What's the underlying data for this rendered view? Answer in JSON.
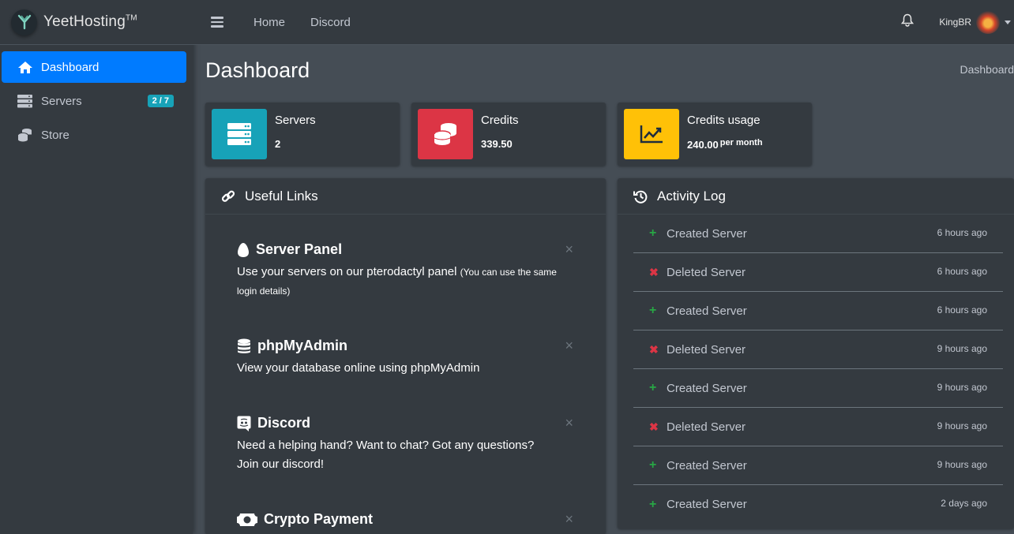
{
  "brand": {
    "name": "YeetHosting",
    "tm": "TM"
  },
  "sidebar": {
    "items": [
      {
        "label": "Dashboard",
        "icon": "home-icon",
        "active": true
      },
      {
        "label": "Servers",
        "icon": "server-icon",
        "badge": "2 / 7"
      },
      {
        "label": "Store",
        "icon": "coins-icon"
      }
    ]
  },
  "topnav": {
    "links": [
      "Home",
      "Discord"
    ],
    "username": "KingBR"
  },
  "page": {
    "title": "Dashboard",
    "breadcrumb": "Dashboard"
  },
  "info_boxes": [
    {
      "label": "Servers",
      "value": "2",
      "color": "#17a2b8",
      "icon": "server-icon"
    },
    {
      "label": "Credits",
      "value": "339.50",
      "color": "#dc3545",
      "icon": "coins-icon"
    },
    {
      "label": "Credits usage",
      "value": "240.00",
      "suffix": "per month",
      "color": "#ffc107",
      "icon": "chart-line-icon"
    }
  ],
  "useful_links": {
    "title": "Useful Links",
    "items": [
      {
        "title": "Server Panel",
        "text": "Use your servers on our pterodactyl panel",
        "small": "(You can use the same login details)",
        "icon": "egg-icon"
      },
      {
        "title": "phpMyAdmin",
        "text": "View your database online using phpMyAdmin",
        "icon": "database-icon"
      },
      {
        "title": "Discord",
        "text": "Need a helping hand? Want to chat? Got any questions? Join our discord!",
        "icon": "discord-icon"
      },
      {
        "title": "Crypto Payment",
        "icon": "money-bill-icon"
      }
    ]
  },
  "activity_log": {
    "title": "Activity Log",
    "rows": [
      {
        "type": "created",
        "text": "Created Server",
        "time": "6 hours ago"
      },
      {
        "type": "deleted",
        "text": "Deleted Server",
        "time": "6 hours ago"
      },
      {
        "type": "created",
        "text": "Created Server",
        "time": "6 hours ago"
      },
      {
        "type": "deleted",
        "text": "Deleted Server",
        "time": "9 hours ago"
      },
      {
        "type": "created",
        "text": "Created Server",
        "time": "9 hours ago"
      },
      {
        "type": "deleted",
        "text": "Deleted Server",
        "time": "9 hours ago"
      },
      {
        "type": "created",
        "text": "Created Server",
        "time": "9 hours ago"
      },
      {
        "type": "created",
        "text": "Created Server",
        "time": "2 days ago"
      }
    ]
  }
}
